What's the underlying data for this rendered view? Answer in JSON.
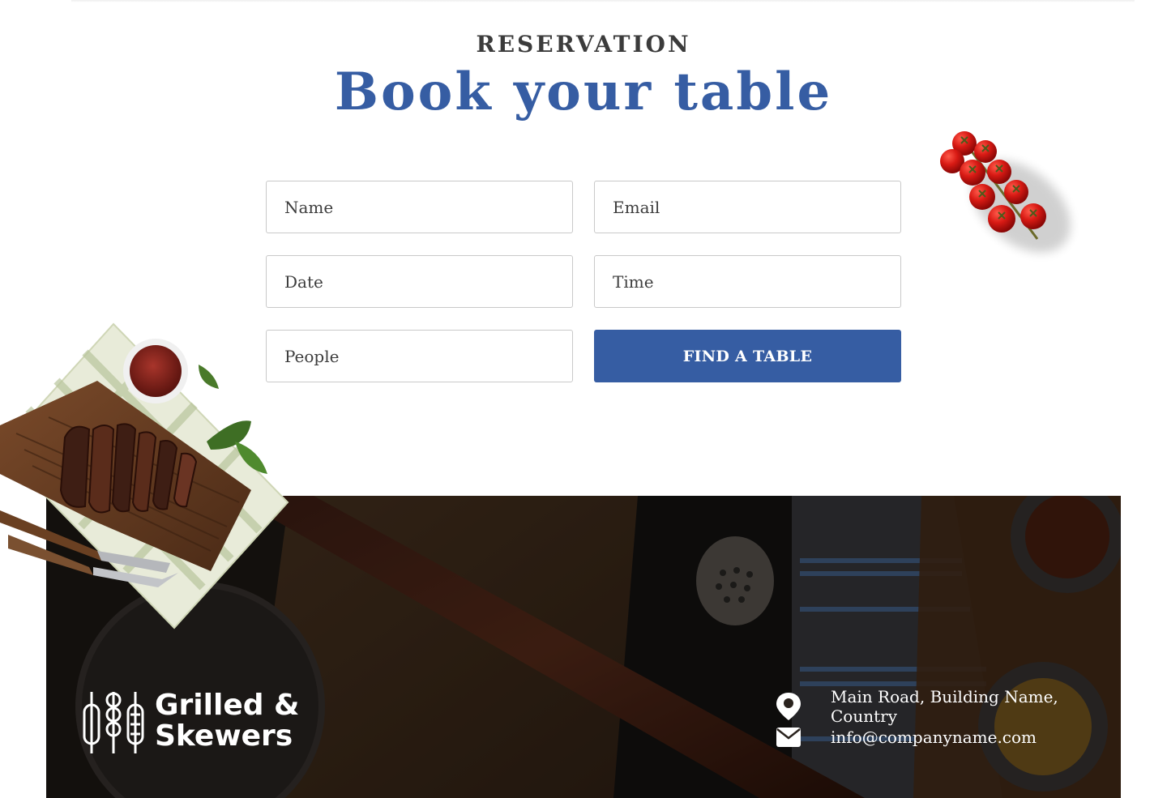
{
  "section": {
    "eyebrow": "RESERVATION",
    "title": "Book your table"
  },
  "form": {
    "name_placeholder": "Name",
    "email_placeholder": "Email",
    "date_placeholder": "Date",
    "time_placeholder": "Time",
    "people_placeholder": "People",
    "submit_label": "FIND A TABLE"
  },
  "footer": {
    "brand_line1": "Grilled &",
    "brand_line2": "Skewers",
    "address": "Main Road, Building Name, Country",
    "email": "info@companyname.com"
  },
  "colors": {
    "accent": "#365da3",
    "heading_dark": "#3b3b3b",
    "footer_bg": "#231d18"
  },
  "icons": [
    "map-pin-icon",
    "envelope-icon",
    "skewers-logo-icon"
  ]
}
